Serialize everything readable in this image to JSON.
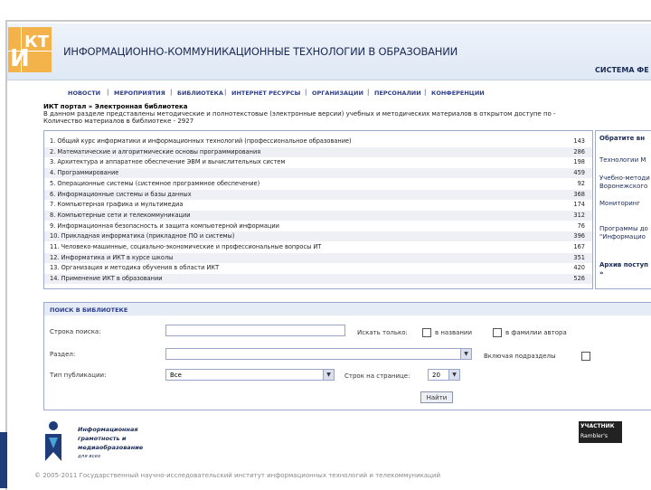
{
  "header": {
    "logo_text": "ИКТ",
    "title": "ИНФОРМАЦИОННО-КОММУНИКАЦИОННЫЕ ТЕХНОЛОГИИ В ОБРАЗОВАНИИ",
    "system": "СИСТЕМА ФЕ"
  },
  "nav": [
    "НОВОСТИ",
    "МЕРОПРИЯТИЯ",
    "БИБЛИОТЕКА",
    "ИНТЕРНЕТ РЕСУРСЫ",
    "ОРГАНИЗАЦИИ",
    "ПЕРСОНАЛИИ",
    "КОНФЕРЕНЦИИ"
  ],
  "breadcrumb": "ИКТ портал » Электронная библиотека",
  "intro": {
    "line1": "В данном разделе представлены методические и полнотекстовые (электронные версии) учебных и методических материалов в открытом доступе по -",
    "line2": "Количество материалов в библиотеке - 2927"
  },
  "categories": [
    {
      "label": "1. Общий курс информатики и информационных технологий (профессиональное образование)",
      "count": "143"
    },
    {
      "label": "2. Математические и алгоритмические основы программирования",
      "count": "286"
    },
    {
      "label": "3. Архитектура и аппаратное обеспечение ЭВМ и вычислительных систем",
      "count": "198"
    },
    {
      "label": "4. Программирование",
      "count": "459"
    },
    {
      "label": "5. Операционные системы (системное программное обеспечение)",
      "count": "92"
    },
    {
      "label": "6. Информационные системы и базы данных",
      "count": "368"
    },
    {
      "label": "7. Компьютерная графика и мультимедиа",
      "count": "174"
    },
    {
      "label": "8. Компьютерные сети и телекоммуникации",
      "count": "312"
    },
    {
      "label": "9. Информационная безопасность и защита компьютерной информации",
      "count": "76"
    },
    {
      "label": "10. Прикладная информатика (прикладное ПО и системы)",
      "count": "396"
    },
    {
      "label": "11. Человеко-машинные, социально-экономические и профессиональные вопросы ИТ",
      "count": "167"
    },
    {
      "label": "12. Информатика и ИКТ в курсе школы",
      "count": "351"
    },
    {
      "label": "13. Организация и методика обучения в области ИКТ",
      "count": "420"
    },
    {
      "label": "14. Применение ИКТ в образовании",
      "count": "526"
    }
  ],
  "side": {
    "heading": "Обратите вн",
    "items": [
      "Технологии М",
      "Учебно-методи",
      "Воронежского",
      "Мониторинг",
      "Программы до",
      "\"Информацио",
      "Архив поступ",
      "»"
    ]
  },
  "search": {
    "heading": "ПОИСК В БИБЛИОТЕКЕ",
    "query_label": "Строка поиска:",
    "query_value": "",
    "search_only_label": "Искать только:",
    "in_titles_label": "в названии",
    "in_authors_label": "в фамилии автора",
    "section_label": "Раздел:",
    "section_value": "",
    "include_sub_label": "Включая подразделы",
    "pubtype_label": "Тип публикации:",
    "pubtype_value": "Все",
    "perpage_label": "Строк на странице:",
    "perpage_value": "20",
    "submit_label": "Найти"
  },
  "footer": {
    "logo_line1": "Информационная",
    "logo_line2": "грамотность и",
    "logo_line3": "медиаобразование",
    "logo_line4": "для всех",
    "counter_line1": "УЧАСТНИК",
    "counter_line2": "Rambler's",
    "copyright": "© 2005-2011 Государственный научно-исследовательский институт информационных технологий и телекоммуникаций"
  }
}
